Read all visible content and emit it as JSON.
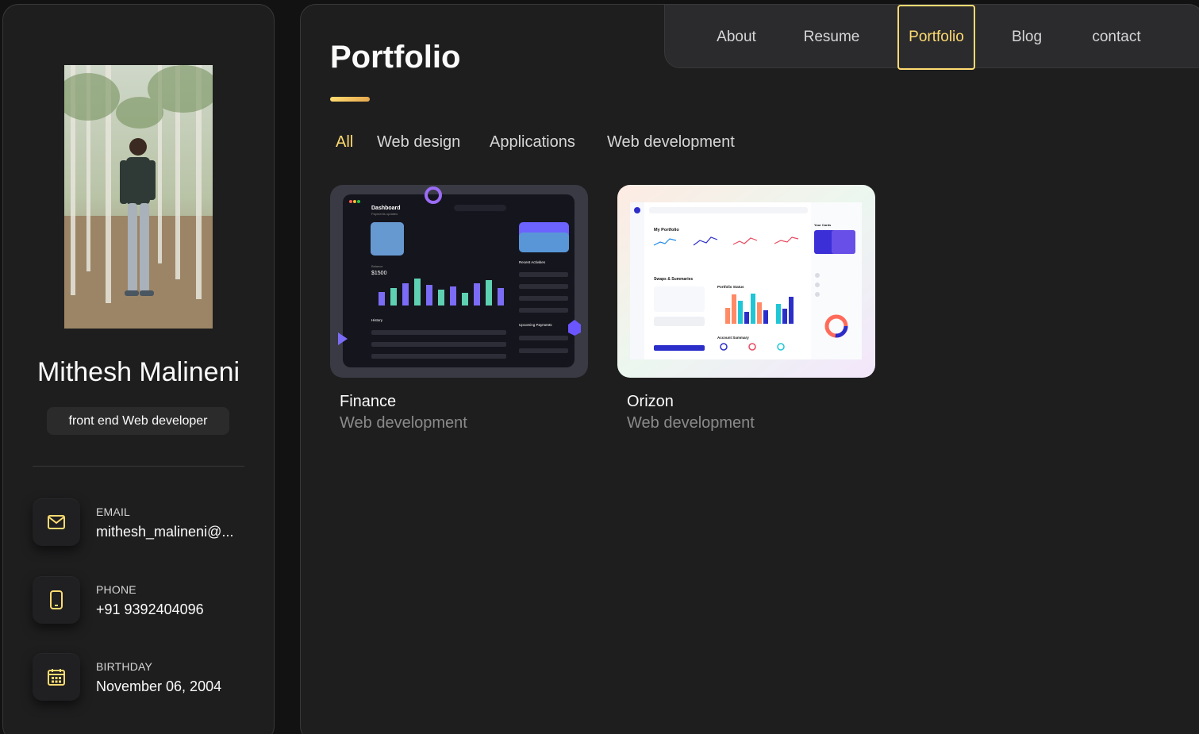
{
  "profile": {
    "name": "Mithesh Malineni",
    "title": "front end Web developer"
  },
  "contacts": [
    {
      "label": "EMAIL",
      "value": "mithesh_malineni@...",
      "icon": "mail-icon"
    },
    {
      "label": "PHONE",
      "value": "+91 9392404096",
      "icon": "phone-icon"
    },
    {
      "label": "BIRTHDAY",
      "value": "November 06, 2004",
      "icon": "calendar-icon"
    }
  ],
  "nav": {
    "items": [
      "About",
      "Resume",
      "Portfolio",
      "Blog",
      "contact"
    ],
    "active": "Portfolio"
  },
  "page": {
    "title": "Portfolio"
  },
  "filters": {
    "items": [
      "All",
      "Web design",
      "Applications",
      "Web development"
    ],
    "active": "All"
  },
  "projects": [
    {
      "title": "Finance",
      "category": "Web development",
      "thumb": {
        "header": "Dashboard",
        "subheader": "Payments updates",
        "balance_label": "Balance",
        "balance": "$1500",
        "history": "History",
        "recent": "Recent Activities",
        "upcoming": "Upcoming Payments"
      }
    },
    {
      "title": "Orizon",
      "category": "Web development",
      "thumb": {
        "portfolio": "My Portfolio",
        "swaps": "Swaps & Summaries",
        "status": "Portfolio Status",
        "cards": "Your Cards",
        "account": "Account Summary"
      }
    }
  ],
  "colors": {
    "accent": "#ffdb70",
    "background": "#121212",
    "panel": "#1e1e1f"
  }
}
